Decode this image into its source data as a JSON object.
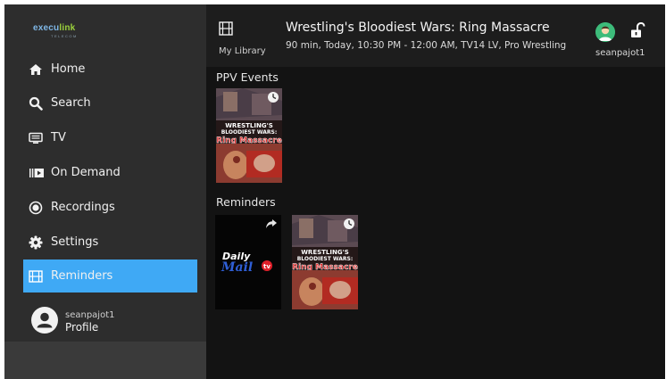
{
  "brand": {
    "logo_part1": "execu",
    "logo_part2": "link",
    "logo_sub": "TELECOM"
  },
  "nav": {
    "items": [
      {
        "label": "Home",
        "icon": "home-icon"
      },
      {
        "label": "Search",
        "icon": "search-icon"
      },
      {
        "label": "TV",
        "icon": "tv-guide-icon"
      },
      {
        "label": "On Demand",
        "icon": "on-demand-icon"
      },
      {
        "label": "Recordings",
        "icon": "record-icon"
      },
      {
        "label": "Settings",
        "icon": "gear-icon"
      },
      {
        "label": "Reminders",
        "icon": "film-icon"
      }
    ],
    "active": "Reminders"
  },
  "profile": {
    "username": "seanpajot1",
    "label": "Profile",
    "icon": "user-icon"
  },
  "header": {
    "library_label": "My Library",
    "title": "Wrestling's Bloodiest Wars: Ring Massacre",
    "meta": "90 min, Today, 10:30 PM - 12:00 AM, TV14 LV, Pro Wrestling",
    "username": "seanpajot1",
    "lock_icon": "unlock-icon"
  },
  "sections": [
    {
      "title": "PPV Events",
      "items": [
        {
          "poster_line1": "WRESTLING'S",
          "poster_line2": "BLOODIEST WARS:",
          "poster_line3": "Ring Massacre",
          "badge": "clock-icon"
        }
      ]
    },
    {
      "title": "Reminders",
      "items": [
        {
          "poster_line1": "Daily",
          "poster_line2": "Mail",
          "poster_line3": "tv",
          "badge": "share-icon"
        },
        {
          "poster_line1": "WRESTLING'S",
          "poster_line2": "BLOODIEST WARS:",
          "poster_line3": "Ring Massacre",
          "badge": "clock-icon"
        }
      ]
    }
  ],
  "colors": {
    "accent": "#3fa9f5",
    "sidebar": "#2d2d2d",
    "background": "#131313",
    "avatar": "#3dbb7a"
  }
}
